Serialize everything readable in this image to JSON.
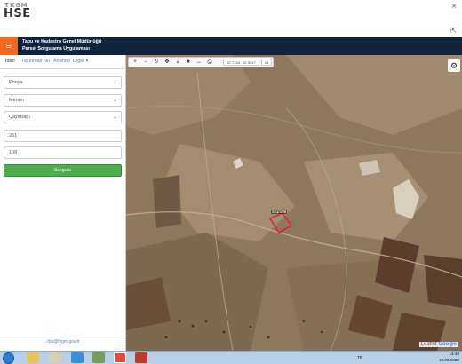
{
  "app": {
    "logo_text": "HSE",
    "logo_sub": "ᴛᴋɢᴍ",
    "close_icon": "×",
    "menu_icon": "⇱"
  },
  "header": {
    "hamburger_icon": "≡",
    "title_line1": "Tapu ve Kadastro Genel Müdürlüğü",
    "title_line2": "Parsel Sorgulama Uygulaması"
  },
  "sidebar": {
    "tabs": [
      {
        "label": "İdari"
      },
      {
        "label": "Taşınmaz No"
      },
      {
        "label": "Anahtar"
      },
      {
        "label": "Diğer ▾"
      }
    ],
    "fields": {
      "province": "Konya",
      "district": "Meram",
      "neighborhood": "Çayırbağı",
      "block": "251",
      "parcel": "108"
    },
    "submit_label": "Sorgula",
    "footer_email": "cbs@tkgm.gov.tr"
  },
  "map": {
    "toolbar": {
      "tools": [
        "+",
        "−",
        "↻",
        "✥",
        "⇣",
        "★",
        "↔",
        "⎙"
      ],
      "coords": "37.7104 , 32.3517",
      "zoom": "16"
    },
    "parcel_label": "251/108",
    "brand": {
      "leaflet": "Leaflet",
      "google": "Google"
    }
  },
  "taskbar": {
    "lang": "TR",
    "time": "14:40",
    "date": "18.09.2020"
  }
}
